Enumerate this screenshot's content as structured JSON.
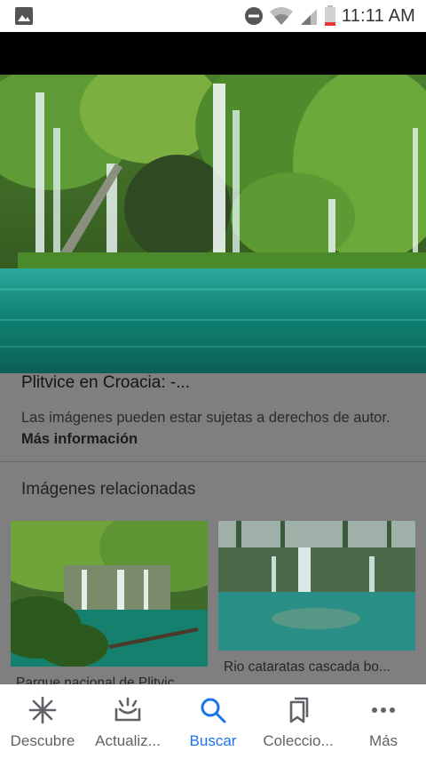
{
  "status_bar": {
    "time": "11:11 AM",
    "icons": [
      "image-icon",
      "do-not-disturb-icon",
      "wifi-icon",
      "signal-icon",
      "battery-icon"
    ]
  },
  "result": {
    "title": "Plitvice en Croacia: -...",
    "copyright_text": "Las imágenes pueden estar sujetas a derechos de autor.",
    "more_info_link": "Más información"
  },
  "related": {
    "heading": "Imágenes relacionadas",
    "items": [
      {
        "caption": "Parque nacional de Plitvic..."
      },
      {
        "caption": "Rio cataratas cascada bo..."
      }
    ]
  },
  "bottom_nav": {
    "items": [
      {
        "label": "Descubre",
        "icon": "asterisk-icon"
      },
      {
        "label": "Actualiz...",
        "icon": "updates-icon"
      },
      {
        "label": "Buscar",
        "icon": "search-icon"
      },
      {
        "label": "Coleccio...",
        "icon": "bookmarks-icon"
      },
      {
        "label": "Más",
        "icon": "more-icon"
      }
    ],
    "active_index": 2,
    "active_color": "#1a73e8"
  }
}
